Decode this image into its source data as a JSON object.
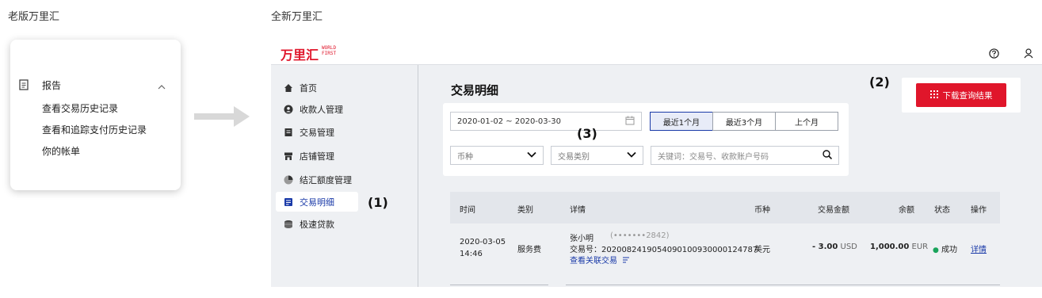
{
  "captions": {
    "old": "老版万里汇",
    "new": "全新万里汇"
  },
  "old_menu": {
    "section_label": "报告",
    "items": [
      "查看交易历史记录",
      "查看和追踪支付历史记录",
      "你的帐单"
    ]
  },
  "app": {
    "logo_text": "万里汇",
    "logo_sub_1": "WORLD",
    "logo_sub_2": "FIRST",
    "sidebar": [
      {
        "label": "首页",
        "icon": "home-icon"
      },
      {
        "label": "收款人管理",
        "icon": "user-icon"
      },
      {
        "label": "交易管理",
        "icon": "document-icon"
      },
      {
        "label": "店铺管理",
        "icon": "store-icon"
      },
      {
        "label": "结汇额度管理",
        "icon": "pie-icon"
      },
      {
        "label": "交易明细",
        "icon": "list-icon"
      },
      {
        "label": "极速贷款",
        "icon": "coins-icon"
      }
    ],
    "page_title": "交易明细",
    "download_label": "下载查询结果",
    "filters": {
      "date_range": "2020-01-02 ~ 2020-03-30",
      "ranges": [
        "最近1个月",
        "最近3个月",
        "上个月"
      ],
      "currency_placeholder": "币种",
      "type_placeholder": "交易类别",
      "search_placeholder": "关键词：交易号、收款账户号码"
    },
    "table": {
      "headers": [
        "时间",
        "类别",
        "详情",
        "币种",
        "交易金额",
        "余额",
        "状态",
        "操作"
      ],
      "row": {
        "date": "2020-03-05",
        "time": "14:46",
        "type": "服务费",
        "name": "张小明",
        "masked_account": "(•••••••2842)",
        "txn_no": "交易号：2020082419054090100930000124787",
        "related_link": "查看关联交易",
        "currency": "美元",
        "amount_value": "- 3.00",
        "amount_unit": "USD",
        "balance_value": "1,000.00",
        "balance_unit": "EUR",
        "status": "成功",
        "action": "详情"
      }
    }
  },
  "callouts": {
    "c1": "(1)",
    "c2": "(2)",
    "c3": "(3)"
  },
  "colors": {
    "brand_red": "#e0162b",
    "link_blue": "#1a3aa8",
    "success_green": "#19a35a"
  }
}
